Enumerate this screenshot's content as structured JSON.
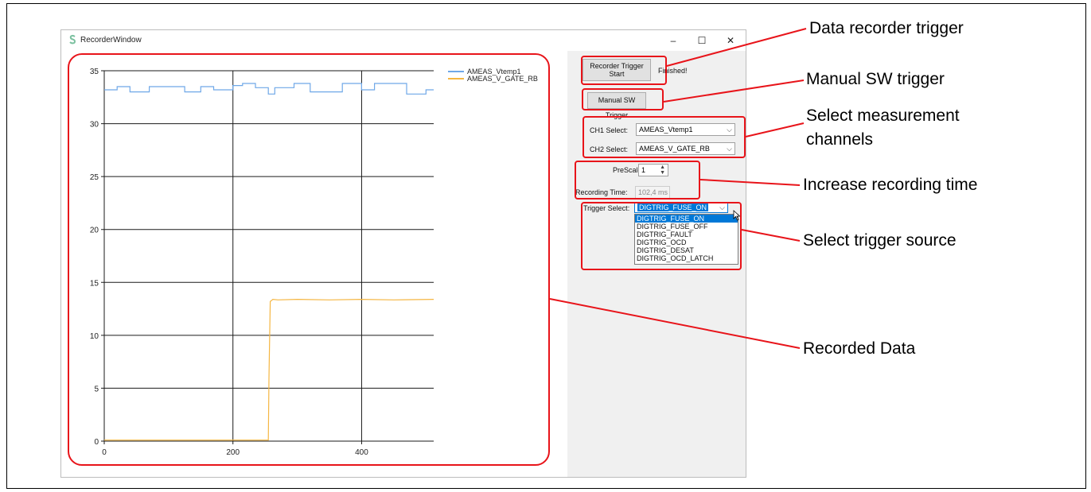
{
  "window": {
    "title": "RecorderWindow",
    "minimize": "–",
    "maximize": "☐",
    "close": "✕"
  },
  "panel": {
    "recorder_trigger_line1": "Recorder Trigger",
    "recorder_trigger_line2": "Start",
    "status": "Finished!",
    "manual_trigger": "Manual SW Trigger",
    "ch1_label": "CH1 Select:",
    "ch1_value": "AMEAS_Vtemp1",
    "ch2_label": "CH2 Select:",
    "ch2_value": "AMEAS_V_GATE_RB",
    "prescaler_label": "PreScaler:",
    "prescaler_value": "1",
    "recording_time_label": "Recording Time:",
    "recording_time_value": "102,4 ms",
    "trigger_label": "Trigger Select:",
    "trigger_value": "DIGTRIG_FUSE_ON",
    "trigger_options": [
      "DIGTRIG_FUSE_ON",
      "DIGTRIG_FUSE_OFF",
      "DIGTRIG_FAULT",
      "DIGTRIG_OCD",
      "DIGTRIG_DESAT",
      "DIGTRIG_OCD_LATCH"
    ]
  },
  "callouts": {
    "data_recorder_trigger": "Data recorder trigger",
    "manual_sw_trigger": "Manual SW trigger",
    "select_channels_line1": "Select measurement",
    "select_channels_line2": "channels",
    "increase_time": "Increase recording time",
    "select_trigger": "Select trigger source",
    "recorded_data": "Recorded Data"
  },
  "colors": {
    "series1": "#6fa8e8",
    "series2": "#f5b642",
    "annotation": "#e8141a"
  },
  "chart_data": {
    "type": "line",
    "xlim": [
      0,
      512
    ],
    "ylim": [
      0,
      35
    ],
    "xticks": [
      0,
      200,
      400
    ],
    "yticks": [
      0,
      5,
      10,
      15,
      20,
      25,
      30,
      35
    ],
    "grid": true,
    "legend_position": "top-right",
    "series": [
      {
        "name": "AMEAS_Vtemp1",
        "x": [
          0,
          20,
          20,
          40,
          40,
          70,
          70,
          125,
          125,
          150,
          150,
          170,
          170,
          200,
          200,
          215,
          215,
          235,
          235,
          255,
          255,
          265,
          265,
          295,
          295,
          320,
          320,
          370,
          370,
          400,
          400,
          420,
          420,
          470,
          470,
          500,
          500,
          512
        ],
        "y": [
          33.2,
          33.2,
          33.5,
          33.5,
          33.0,
          33.0,
          33.5,
          33.5,
          33.0,
          33.0,
          33.5,
          33.5,
          33.2,
          33.2,
          33.6,
          33.6,
          33.8,
          33.8,
          33.4,
          33.4,
          32.8,
          32.8,
          33.4,
          33.4,
          33.8,
          33.8,
          33.0,
          33.0,
          33.8,
          33.8,
          33.2,
          33.2,
          33.8,
          33.8,
          32.8,
          32.8,
          33.2,
          33.2
        ]
      },
      {
        "name": "AMEAS_V_GATE_RB",
        "x": [
          0,
          255,
          256,
          258,
          262,
          270,
          300,
          350,
          400,
          450,
          512
        ],
        "y": [
          0.1,
          0.1,
          6.0,
          13.2,
          13.4,
          13.35,
          13.4,
          13.35,
          13.4,
          13.35,
          13.4
        ]
      }
    ]
  }
}
